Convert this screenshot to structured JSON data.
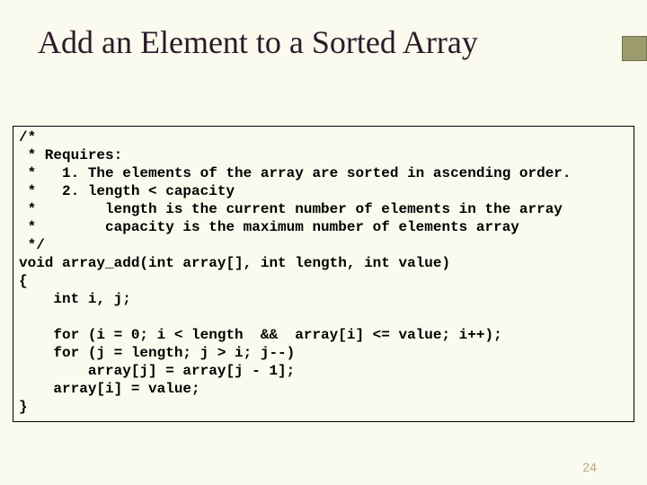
{
  "title": "Add an Element to a Sorted Array",
  "code": "/*\n * Requires:\n *   1. The elements of the array are sorted in ascending order.\n *   2. length < capacity\n *        length is the current number of elements in the array\n *        capacity is the maximum number of elements array\n */\nvoid array_add(int array[], int length, int value)\n{\n    int i, j;\n\n    for (i = 0; i < length  &&  array[i] <= value; i++);\n    for (j = length; j > i; j--)\n        array[j] = array[j - 1];\n    array[i] = value;\n}",
  "page_number": "24"
}
